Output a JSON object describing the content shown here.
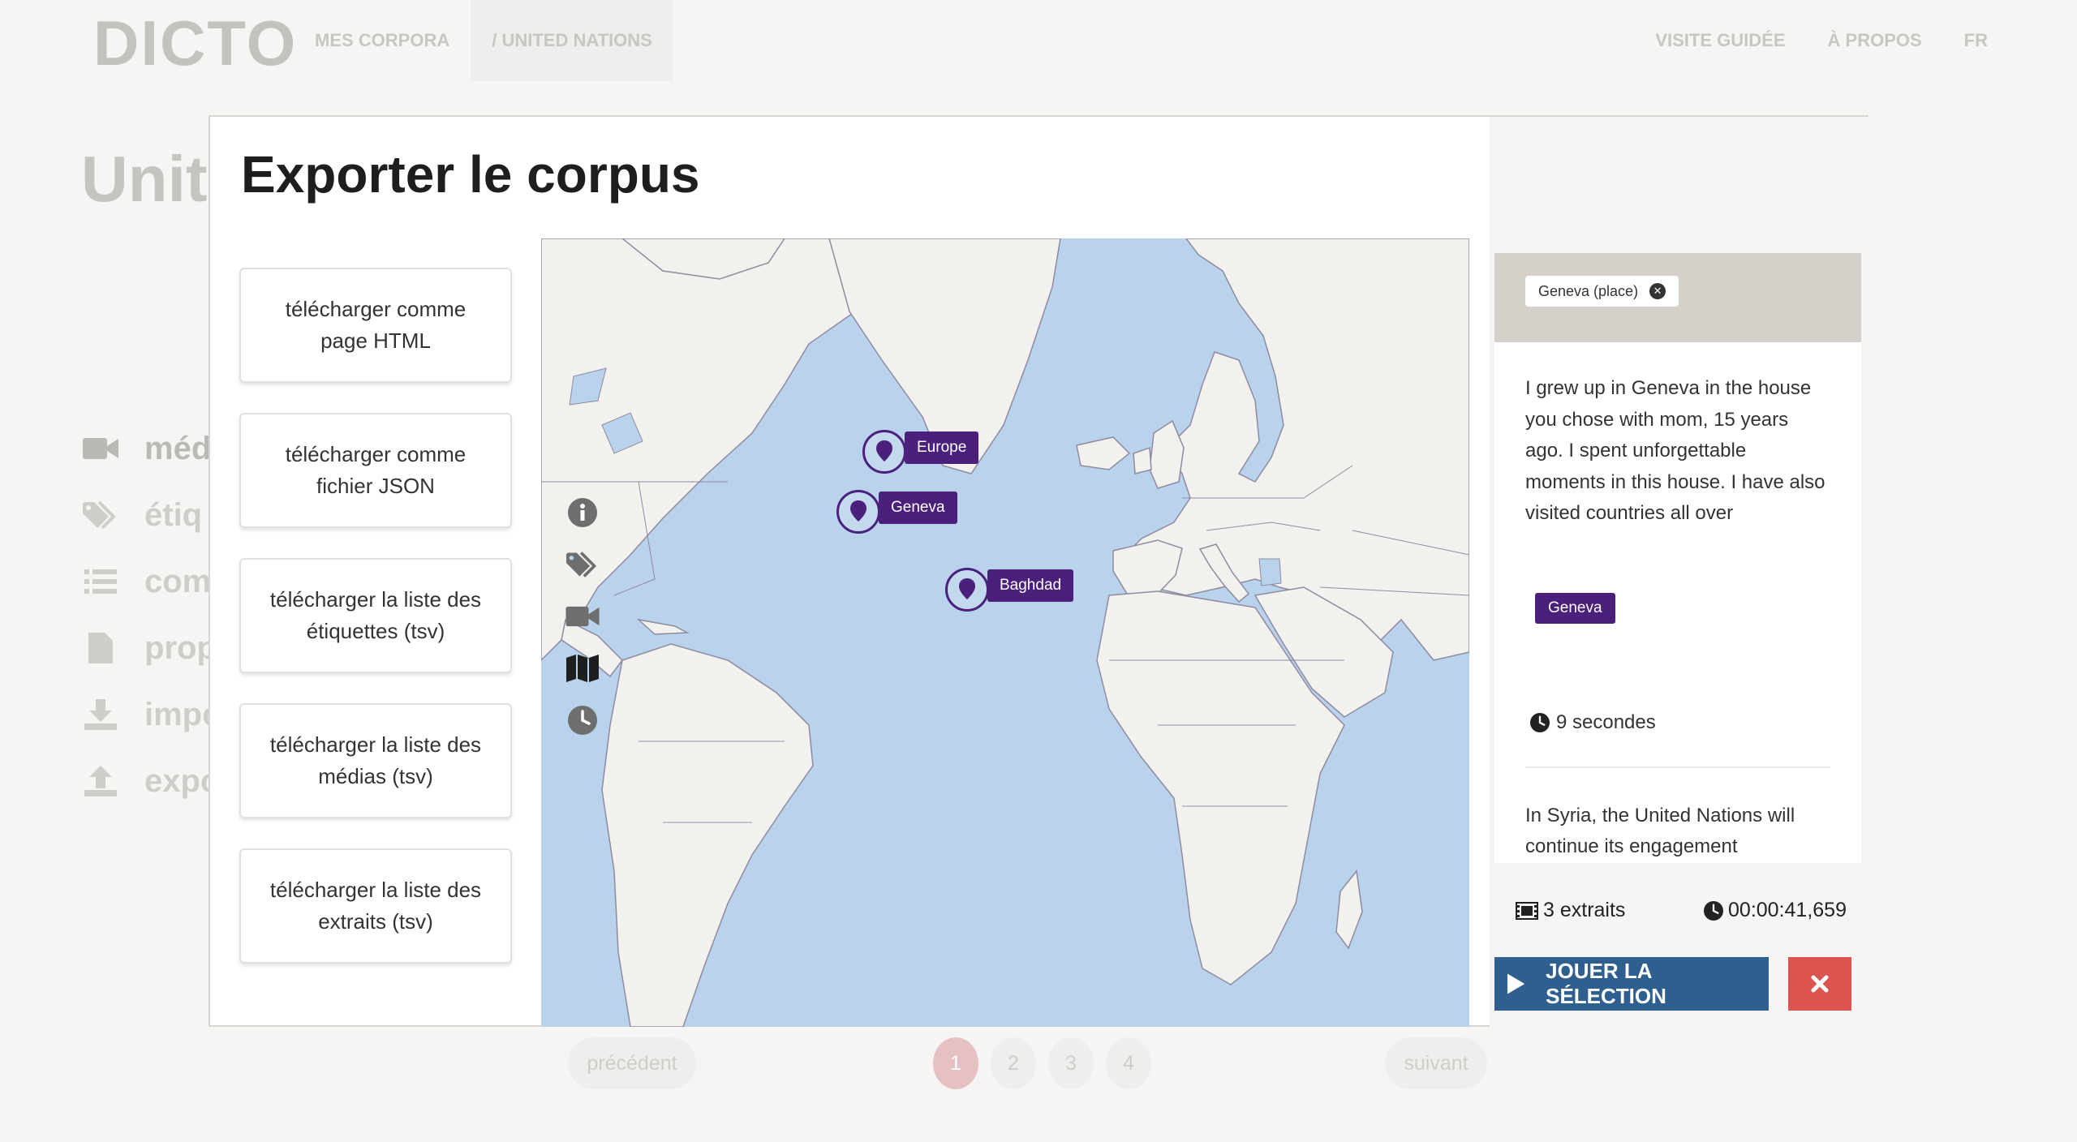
{
  "app": {
    "logo": "DICTO",
    "nav": {
      "corpora": "MES CORPORA",
      "current": "/ UNITED NATIONS",
      "tour": "VISITE GUIDÉE",
      "about": "À PROPOS",
      "lang": "FR"
    },
    "page_title": "Unit",
    "sidemenu": [
      "méd",
      "étiq",
      "com",
      "prop",
      "impo",
      "expo"
    ],
    "pager": {
      "prev": "précédent",
      "pages": [
        "1",
        "2",
        "3",
        "4"
      ],
      "next": "suivant"
    }
  },
  "modal": {
    "title": "Exporter le corpus",
    "exports": [
      "télécharger comme\npage HTML",
      "télécharger comme\nfichier JSON",
      "télécharger la liste des\nétiquettes (tsv)",
      "télécharger la liste des\nmédias (tsv)",
      "télécharger la liste des\nextraits (tsv)"
    ],
    "map": {
      "tools": [
        "info-icon",
        "tags-icon",
        "video-icon",
        "map-icon",
        "clock-icon"
      ],
      "markers": [
        "Europe",
        "Geneva",
        "Baghdad"
      ]
    },
    "panel": {
      "filter_chip": "Geneva (place)",
      "extract1": {
        "text": "I grew up in Geneva in the house you chose with mom, 15 years ago. I spent unforgettable moments in this house. I have also visited countries all over",
        "badge": "Geneva",
        "duration": "9 secondes"
      },
      "extract2": {
        "text": "In Syria, the United Nations will continue its engagement"
      },
      "count": "3 extraits",
      "total": "00:00:41,659",
      "play": "JOUER LA SÉLECTION"
    }
  },
  "colors": {
    "accent": "#4b1f7c",
    "play": "#2f5f8e",
    "danger": "#db5450",
    "water": "#b9d3ec",
    "land": "#f3f1ee"
  }
}
